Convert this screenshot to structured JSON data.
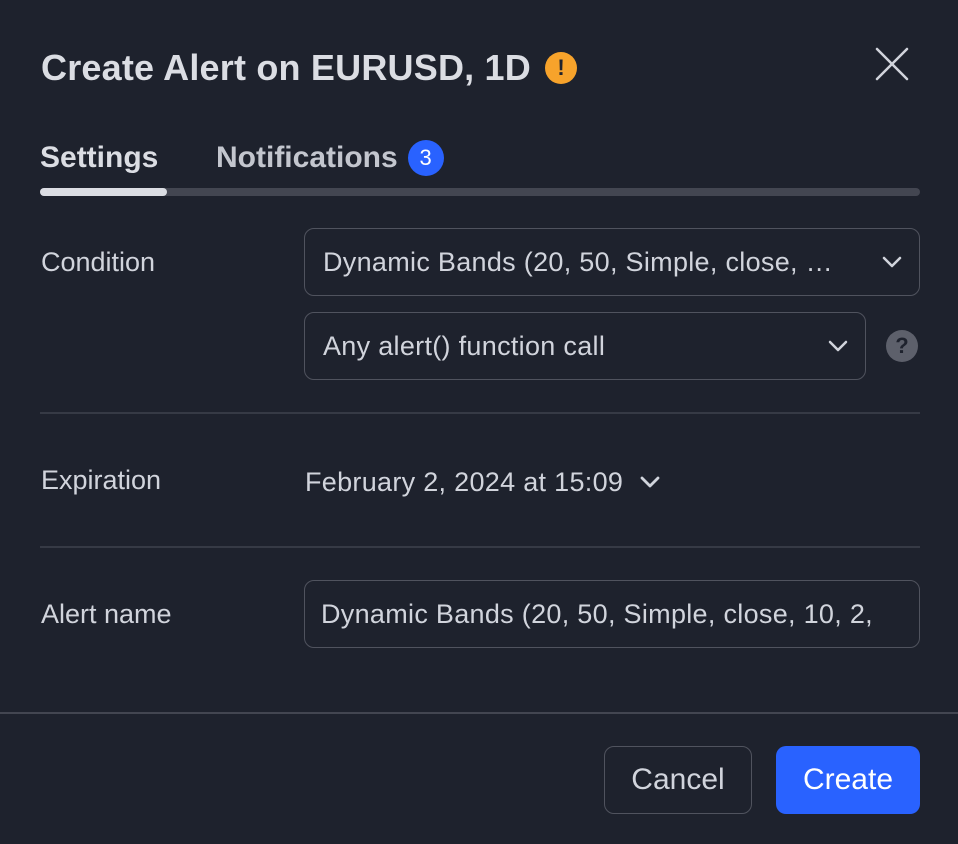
{
  "dialog": {
    "title": "Create Alert on EURUSD, 1D",
    "warning_icon": "exclamation-icon",
    "warning_icon_glyph": "!",
    "warning_color": "#f7a32b",
    "close_icon": "close-icon"
  },
  "tabs": [
    {
      "label": "Settings",
      "active": true
    },
    {
      "label": "Notifications",
      "badge": "3",
      "active": false
    }
  ],
  "condition": {
    "label": "Condition",
    "primary_value": "Dynamic Bands (20, 50, Simple, close, …",
    "secondary_value": "Any alert() function call",
    "help_glyph": "?"
  },
  "expiration": {
    "label": "Expiration",
    "value": "February 2, 2024 at 15:09"
  },
  "alert_name": {
    "label": "Alert name",
    "value": "Dynamic Bands (20, 50, Simple, close, 10, 2,"
  },
  "footer": {
    "cancel_label": "Cancel",
    "create_label": "Create"
  },
  "colors": {
    "background": "#1e222d",
    "accent": "#2962ff",
    "border": "#50535e",
    "text": "#d1d4dc"
  }
}
